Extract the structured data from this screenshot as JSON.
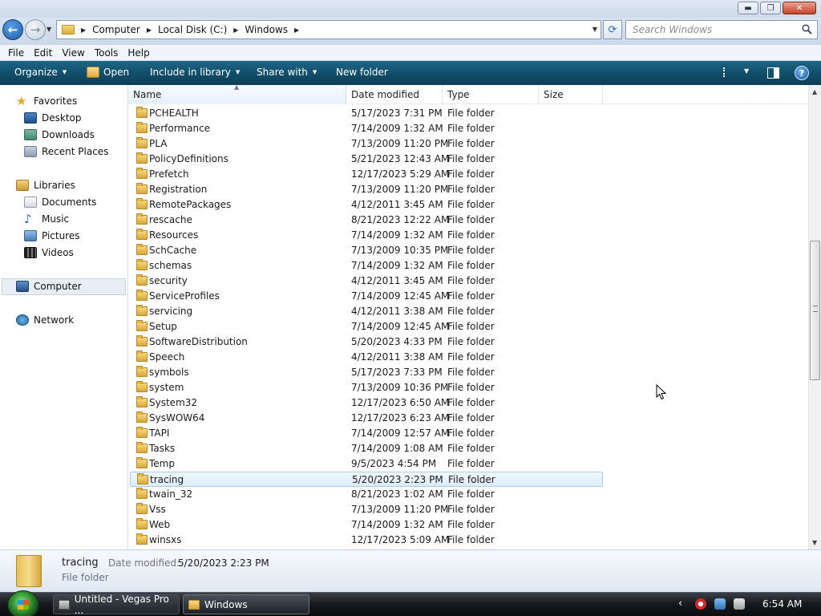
{
  "window": {
    "controls": {
      "minimize": "▬",
      "maximize": "❐",
      "close": "✕"
    }
  },
  "address": {
    "breadcrumbs": [
      "Computer",
      "Local Disk (C:)",
      "Windows"
    ],
    "search_placeholder": "Search Windows"
  },
  "menu": [
    "File",
    "Edit",
    "View",
    "Tools",
    "Help"
  ],
  "commands": {
    "organize": "Organize",
    "open": "Open",
    "include_in_library": "Include in library",
    "share_with": "Share with",
    "new_folder": "New folder",
    "help": "?"
  },
  "nav": {
    "favorites": "Favorites",
    "desktop": "Desktop",
    "downloads": "Downloads",
    "recent_places": "Recent Places",
    "libraries": "Libraries",
    "documents": "Documents",
    "music": "Music",
    "pictures": "Pictures",
    "videos": "Videos",
    "computer": "Computer",
    "network": "Network"
  },
  "columns": {
    "name": "Name",
    "date": "Date modified",
    "type": "Type",
    "size": "Size"
  },
  "files": [
    {
      "name": "PCHEALTH",
      "date": "5/17/2023 7:31 PM",
      "type": "File folder"
    },
    {
      "name": "Performance",
      "date": "7/14/2009 1:32 AM",
      "type": "File folder"
    },
    {
      "name": "PLA",
      "date": "7/13/2009 11:20 PM",
      "type": "File folder"
    },
    {
      "name": "PolicyDefinitions",
      "date": "5/21/2023 12:43 AM",
      "type": "File folder"
    },
    {
      "name": "Prefetch",
      "date": "12/17/2023 5:29 AM",
      "type": "File folder"
    },
    {
      "name": "Registration",
      "date": "7/13/2009 11:20 PM",
      "type": "File folder"
    },
    {
      "name": "RemotePackages",
      "date": "4/12/2011 3:45 AM",
      "type": "File folder"
    },
    {
      "name": "rescache",
      "date": "8/21/2023 12:22 AM",
      "type": "File folder"
    },
    {
      "name": "Resources",
      "date": "7/14/2009 1:32 AM",
      "type": "File folder"
    },
    {
      "name": "SchCache",
      "date": "7/13/2009 10:35 PM",
      "type": "File folder"
    },
    {
      "name": "schemas",
      "date": "7/14/2009 1:32 AM",
      "type": "File folder"
    },
    {
      "name": "security",
      "date": "4/12/2011 3:45 AM",
      "type": "File folder"
    },
    {
      "name": "ServiceProfiles",
      "date": "7/14/2009 12:45 AM",
      "type": "File folder"
    },
    {
      "name": "servicing",
      "date": "4/12/2011 3:38 AM",
      "type": "File folder"
    },
    {
      "name": "Setup",
      "date": "7/14/2009 12:45 AM",
      "type": "File folder"
    },
    {
      "name": "SoftwareDistribution",
      "date": "5/20/2023 4:33 PM",
      "type": "File folder"
    },
    {
      "name": "Speech",
      "date": "4/12/2011 3:38 AM",
      "type": "File folder"
    },
    {
      "name": "symbols",
      "date": "5/17/2023 7:33 PM",
      "type": "File folder"
    },
    {
      "name": "system",
      "date": "7/13/2009 10:36 PM",
      "type": "File folder"
    },
    {
      "name": "System32",
      "date": "12/17/2023 6:50 AM",
      "type": "File folder"
    },
    {
      "name": "SysWOW64",
      "date": "12/17/2023 6:23 AM",
      "type": "File folder"
    },
    {
      "name": "TAPI",
      "date": "7/14/2009 12:57 AM",
      "type": "File folder"
    },
    {
      "name": "Tasks",
      "date": "7/14/2009 1:08 AM",
      "type": "File folder"
    },
    {
      "name": "Temp",
      "date": "9/5/2023 4:54 PM",
      "type": "File folder"
    },
    {
      "name": "tracing",
      "date": "5/20/2023 2:23 PM",
      "type": "File folder",
      "selected": true
    },
    {
      "name": "twain_32",
      "date": "8/21/2023 1:02 AM",
      "type": "File folder"
    },
    {
      "name": "Vss",
      "date": "7/13/2009 11:20 PM",
      "type": "File folder"
    },
    {
      "name": "Web",
      "date": "7/14/2009 1:32 AM",
      "type": "File folder"
    },
    {
      "name": "winsxs",
      "date": "12/17/2023 5:09 AM",
      "type": "File folder"
    }
  ],
  "details": {
    "name": "tracing",
    "date_label": "Date modified:",
    "date_value": "5/20/2023 2:23 PM",
    "type": "File folder"
  },
  "taskbar": {
    "tasks": [
      "Untitled - Vegas Pro ...",
      "Windows"
    ],
    "clock": "6:54 AM"
  },
  "colors": {
    "command_bar": "#114d69",
    "selection": "#dcecfc",
    "folder": "#e8be55"
  }
}
